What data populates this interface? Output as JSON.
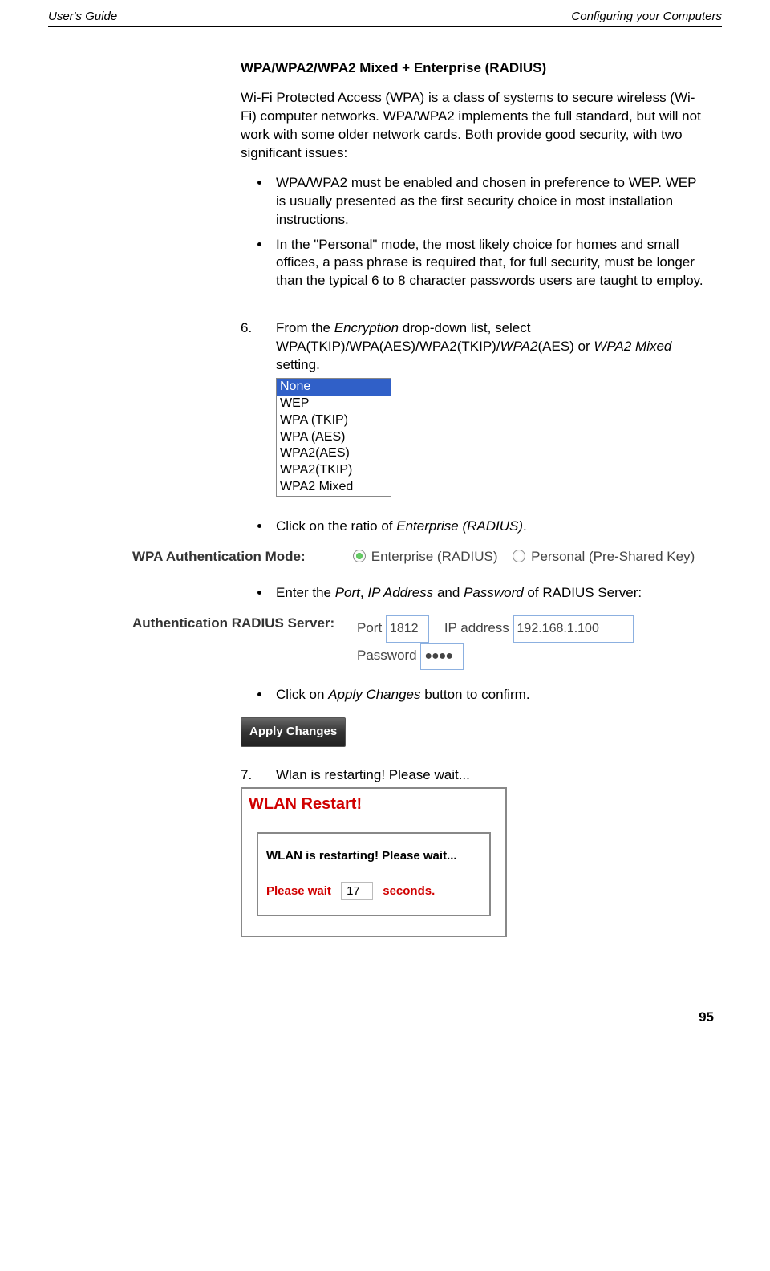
{
  "header": {
    "left": "User's Guide",
    "right": "Configuring your Computers"
  },
  "title": "WPA/WPA2/WPA2 Mixed + Enterprise (RADIUS)",
  "intro": "Wi-Fi Protected Access (WPA) is a class of systems to secure wireless (Wi-Fi) computer networks. WPA/WPA2 implements the full standard, but will not work with some older network cards. Both provide good security, with two significant issues:",
  "issues": [
    "WPA/WPA2 must be enabled and chosen in preference to WEP. WEP is usually presented as the first security choice in most installation instructions.",
    "In the \"Personal\" mode, the most likely choice for homes and small offices, a pass phrase is required that, for full security, must be longer than the typical 6 to 8 character passwords users are taught to employ."
  ],
  "step6": {
    "num": "6.",
    "pre": "From the ",
    "enc": "Encryption",
    "mid": " drop-down list, select WPA(TKIP)/WPA(AES)/WPA2(TKIP)/",
    "wpa2": "WPA2",
    "aes": "(AES) or ",
    "mixed": "WPA2 Mixed",
    "post": " setting."
  },
  "dropdown": {
    "options": [
      "None",
      "WEP",
      "WPA (TKIP)",
      "WPA (AES)",
      "WPA2(AES)",
      "WPA2(TKIP)",
      "WPA2 Mixed"
    ],
    "selected": 0
  },
  "bullet_radio": {
    "pre": "Click on the ratio of ",
    "em": "Enterprise (RADIUS)",
    "post": "."
  },
  "wpa_auth": {
    "label": "WPA Authentication Mode:",
    "opt1": "Enterprise (RADIUS)",
    "opt2": "Personal (Pre-Shared Key)"
  },
  "bullet_radius": {
    "pre": "Enter the ",
    "p1": "Port",
    "c1": ", ",
    "p2": "IP Address",
    "c2": " and ",
    "p3": "Password",
    "post": " of RADIUS Server:"
  },
  "radius": {
    "label": "Authentication RADIUS Server:",
    "port_lbl": "Port",
    "port_val": "1812",
    "ip_lbl": "IP address",
    "ip_val": "192.168.1.100",
    "pw_lbl": "Password",
    "pw_val": "●●●●"
  },
  "bullet_apply": {
    "pre": "Click on ",
    "em": "Apply Changes",
    "post": " button to confirm."
  },
  "apply_button": "Apply Changes",
  "step7": {
    "num": "7.",
    "text": "Wlan is restarting! Please wait..."
  },
  "wlan": {
    "title": "WLAN Restart!",
    "msg": "WLAN is restarting! Please wait...",
    "wait_pre": "Please wait",
    "wait_cnt": "17",
    "wait_post": "seconds."
  },
  "page_number": "95"
}
